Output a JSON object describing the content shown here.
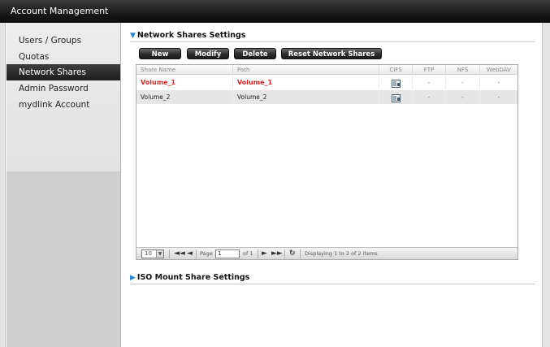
{
  "window": {
    "title": "Account Management"
  },
  "sidebar": {
    "items": [
      {
        "label": "Users / Groups",
        "active": false
      },
      {
        "label": "Quotas",
        "active": false
      },
      {
        "label": "Network Shares",
        "active": true
      },
      {
        "label": "Admin Password",
        "active": false
      },
      {
        "label": "mydlink Account",
        "active": false
      }
    ]
  },
  "network_shares": {
    "section_title": "Network Shares Settings",
    "toolbar": {
      "new_label": "New",
      "modify_label": "Modify",
      "delete_label": "Delete",
      "reset_label": "Reset Network Shares"
    },
    "columns": [
      "Share Name",
      "Path",
      "CIFS",
      "FTP",
      "NFS",
      "WebDAV"
    ],
    "rows": [
      {
        "share_name": "Volume_1",
        "path": "Volume_1",
        "cifs_icon": "settings-sheet-icon",
        "ftp": "-",
        "nfs": "-",
        "webdav": "-",
        "selected": true
      },
      {
        "share_name": "Volume_2",
        "path": "Volume_2",
        "cifs_icon": "settings-sheet-icon",
        "ftp": "-",
        "nfs": "-",
        "webdav": "-",
        "selected": false
      }
    ],
    "pager": {
      "page_size": "10",
      "page_label": "Page",
      "page_value": "1",
      "of_label": "of 1",
      "status": "Displaying 1 to 2 of 2 items"
    }
  },
  "iso_mount": {
    "section_title": "ISO Mount Share Settings"
  },
  "colors": {
    "accent": "#2a86d6",
    "selected_text": "#e02222",
    "title_bar": "#1a1a1a"
  }
}
